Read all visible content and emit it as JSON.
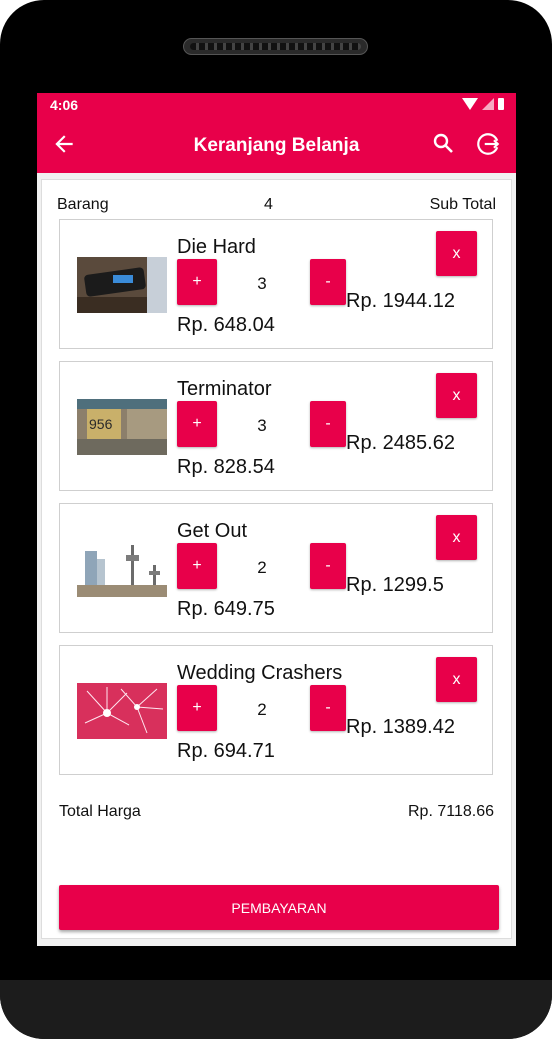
{
  "status": {
    "time": "4:06"
  },
  "toolbar": {
    "title": "Keranjang Belanja"
  },
  "header": {
    "items_label": "Barang",
    "count": "4",
    "subtotal_label": "Sub Total"
  },
  "items": [
    {
      "name": "Die Hard",
      "qty": "3",
      "price": "Rp. 648.04",
      "subtotal": "Rp. 1944.12"
    },
    {
      "name": "Terminator",
      "qty": "3",
      "price": "Rp. 828.54",
      "subtotal": "Rp. 2485.62"
    },
    {
      "name": "Get Out",
      "qty": "2",
      "price": "Rp. 649.75",
      "subtotal": "Rp. 1299.5"
    },
    {
      "name": "Wedding Crashers",
      "qty": "2",
      "price": "Rp. 694.71",
      "subtotal": "Rp. 1389.42"
    }
  ],
  "buttons": {
    "plus": "+",
    "minus": "-",
    "remove": "x"
  },
  "total": {
    "label": "Total Harga",
    "value": "Rp. 7118.66"
  },
  "pay_button": "PEMBAYARAN",
  "thumbs": {
    "0": "thumbnail of an mp3 player",
    "1": "thumbnail of a number plate 956",
    "2": "thumbnail of city towers",
    "3": "thumbnail of fireworks"
  },
  "colors": {
    "accent": "#e8004a"
  }
}
